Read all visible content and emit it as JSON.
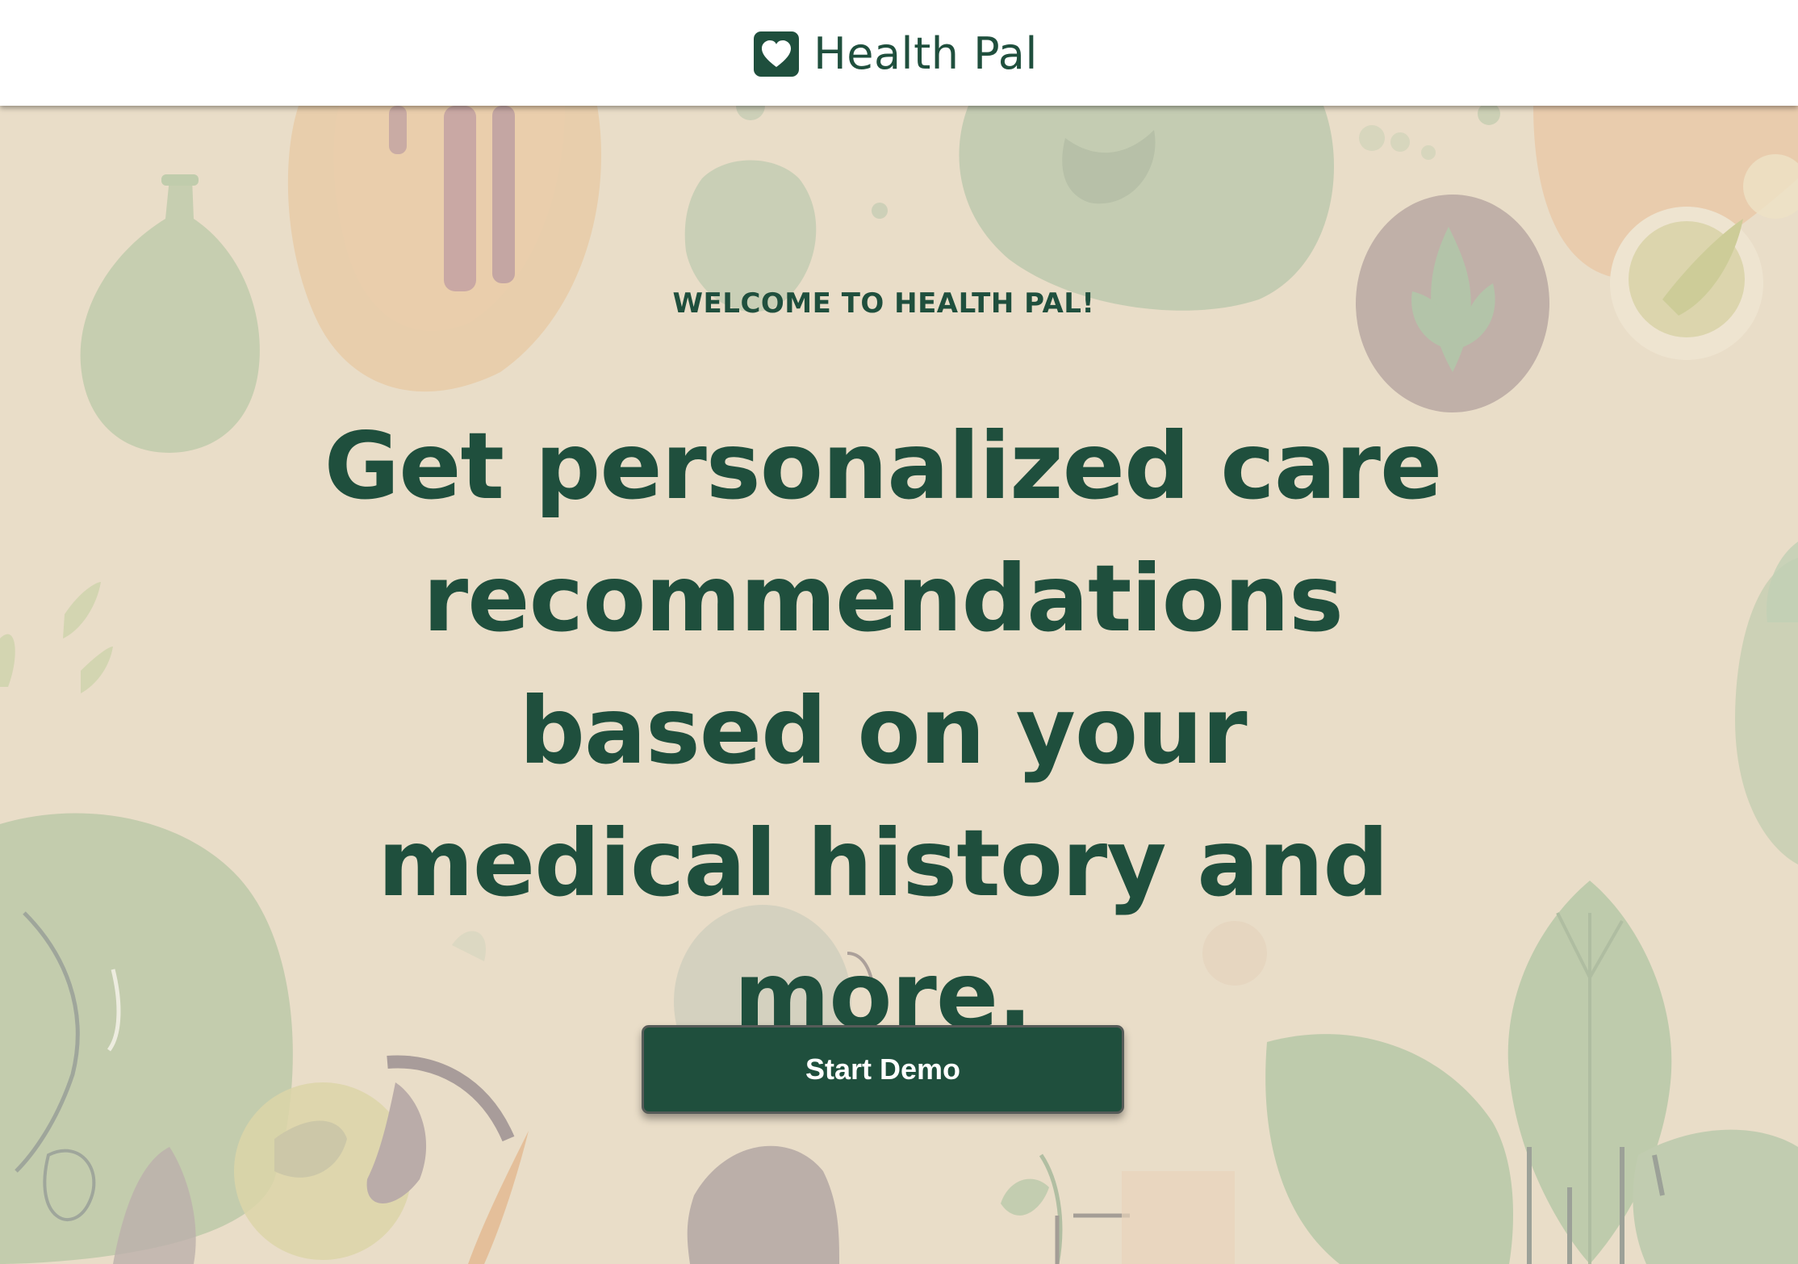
{
  "header": {
    "brand_name": "Health Pal",
    "brand_icon": "heart-icon"
  },
  "hero": {
    "eyebrow": "WELCOME TO HEALTH PAL!",
    "headline": "Get personalized care recommendations based on your medical history and more.",
    "cta_label": "Start Demo"
  },
  "colors": {
    "brand_green": "#1f4f3d",
    "background": "#eaddc8",
    "header_bg": "#ffffff"
  }
}
